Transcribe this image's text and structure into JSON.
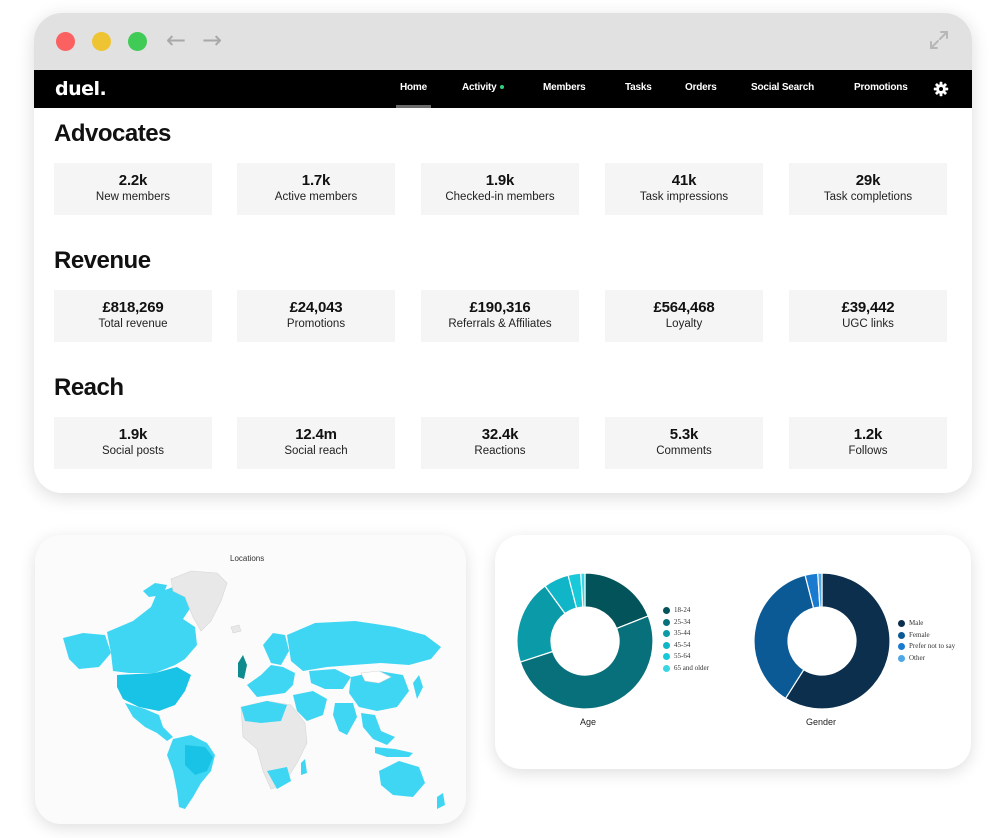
{
  "browser": {
    "back_glyph": "←",
    "forward_glyph": "→"
  },
  "nav": {
    "logo": "duel.",
    "items": [
      {
        "label": "Home",
        "active": true
      },
      {
        "label": "Activity",
        "live": true
      },
      {
        "label": "Members"
      },
      {
        "label": "Tasks"
      },
      {
        "label": "Orders"
      },
      {
        "label": "Social Search"
      },
      {
        "label": "Promotions"
      }
    ],
    "settings_icon": "gear-icon"
  },
  "sections": [
    {
      "title": "Advocates",
      "stats": [
        {
          "value": "2.2k",
          "label": "New members"
        },
        {
          "value": "1.7k",
          "label": "Active members"
        },
        {
          "value": "1.9k",
          "label": "Checked-in members"
        },
        {
          "value": "41k",
          "label": "Task impressions"
        },
        {
          "value": "29k",
          "label": "Task completions"
        }
      ]
    },
    {
      "title": "Revenue",
      "stats": [
        {
          "value": "£818,269",
          "label": "Total revenue"
        },
        {
          "value": "£24,043",
          "label": "Promotions"
        },
        {
          "value": "£190,316",
          "label": "Referrals & Affiliates"
        },
        {
          "value": "£564,468",
          "label": "Loyalty"
        },
        {
          "value": "£39,442",
          "label": "UGC links"
        }
      ]
    },
    {
      "title": "Reach",
      "stats": [
        {
          "value": "1.9k",
          "label": "Social posts"
        },
        {
          "value": "12.4m",
          "label": "Social reach"
        },
        {
          "value": "32.4k",
          "label": "Reactions"
        },
        {
          "value": "5.3k",
          "label": "Comments"
        },
        {
          "value": "1.2k",
          "label": "Follows"
        }
      ]
    }
  ],
  "map": {
    "title": "Locations",
    "colors": {
      "base": "#3fd6f4",
      "highlight": "#18c3e6",
      "dark": "#0aa6c8",
      "strong": "#0e8b8c",
      "none": "#e8e8e8"
    }
  },
  "chart_data": [
    {
      "type": "pie",
      "title": "Age",
      "labels": [
        "18-24",
        "25-34",
        "35-44",
        "45-54",
        "55-64",
        "65 and older"
      ],
      "values": [
        19,
        51,
        20,
        6,
        3,
        1
      ],
      "colors": [
        "#02535a",
        "#08707a",
        "#0b9aa8",
        "#10b5c7",
        "#18c9d9",
        "#38d6e2"
      ]
    },
    {
      "type": "pie",
      "title": "Gender",
      "labels": [
        "Male",
        "Female",
        "Prefer not to say",
        "Other"
      ],
      "values": [
        59,
        37,
        3,
        1
      ],
      "colors": [
        "#0b2f4d",
        "#0b5a96",
        "#1a7ad0",
        "#4ea7e6"
      ]
    }
  ]
}
